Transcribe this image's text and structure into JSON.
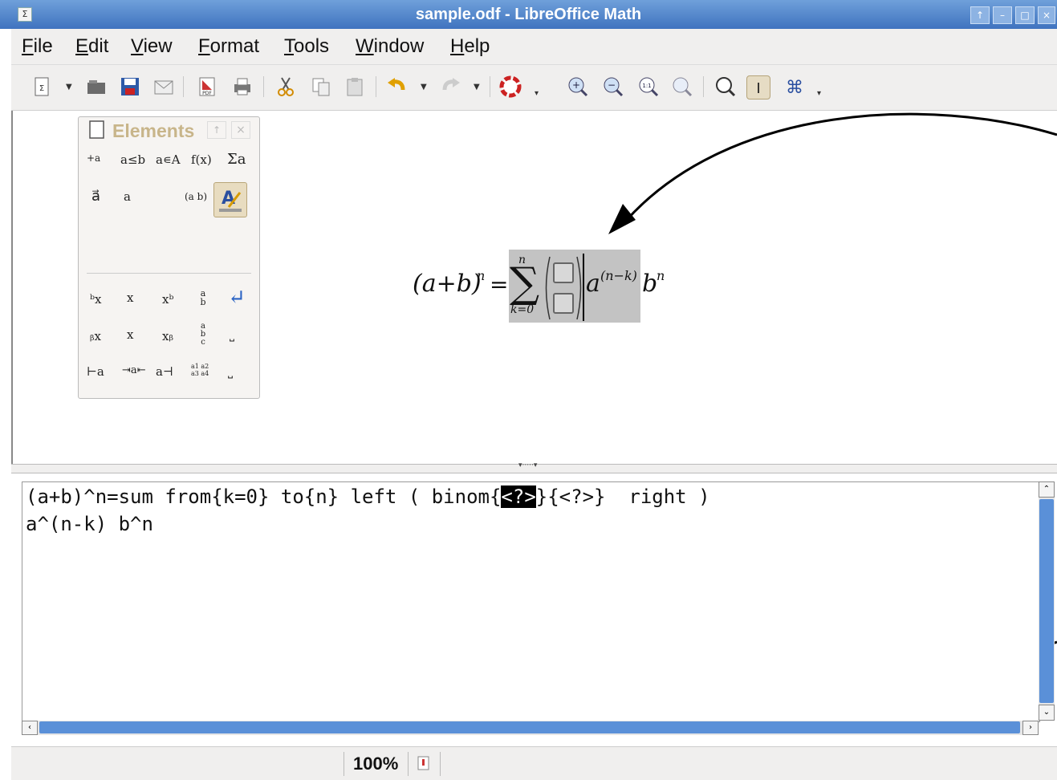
{
  "window": {
    "title": "sample.odf - LibreOffice Math",
    "app_icon_glyph": "Σ",
    "controls": [
      "↑",
      "–",
      "□",
      "×"
    ]
  },
  "menubar": {
    "items": [
      "File",
      "Edit",
      "View",
      "Format",
      "Tools",
      "Window",
      "Help"
    ]
  },
  "elements_panel": {
    "title": "Elements",
    "header_buttons": [
      "↑",
      "×"
    ],
    "category_row1": [
      "+a",
      "a≤b",
      "a∊A",
      "f(x)",
      "Σa"
    ],
    "category_row2": [
      "a⃗",
      "a",
      "(a b)"
    ],
    "row1": [
      "ᵇx",
      "x",
      "xᵇ",
      "a b",
      "↵"
    ],
    "row2": [
      "ᵦx",
      "x",
      "xᵦ",
      "a b c",
      "⎵"
    ],
    "row3": [
      "⊢a",
      "⇥a⇤",
      "a⊣",
      "a1 a2 a3 a4",
      "⎵"
    ]
  },
  "formula": {
    "lhs": "(a+b)",
    "lhs_exp": "n",
    "equals": "=",
    "sum_symbol": "∑",
    "sum_upper": "n",
    "sum_lower": "k=0",
    "term": "a",
    "term_exp": "(n−k)",
    "tail": "b",
    "tail_exp": "n"
  },
  "editor": {
    "line1_before": "(a+b)^n=sum from{k=0} to{n} left ( binom{",
    "line1_selected": "<?>",
    "line1_after": "}{<?>}  right )",
    "line2": "a^(n-k) b^n"
  },
  "statusbar": {
    "zoom": "100%"
  },
  "colors": {
    "titlebar": "#4a7ec7",
    "selection": "#000000",
    "scrollbar": "#5a90d8"
  }
}
